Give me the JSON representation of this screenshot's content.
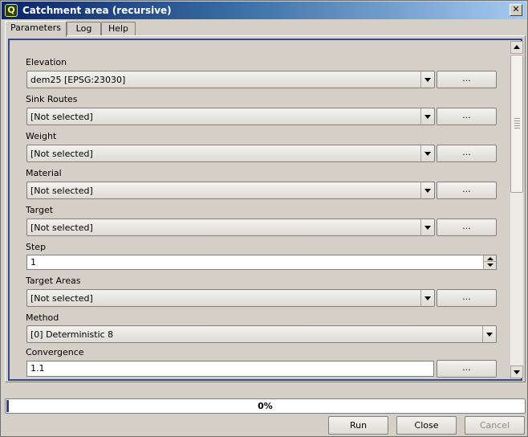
{
  "window": {
    "title": "Catchment area (recursive)",
    "close_glyph": "✕"
  },
  "tabs": [
    {
      "label": "Parameters",
      "active": true
    },
    {
      "label": "Log",
      "active": false
    },
    {
      "label": "Help",
      "active": false
    }
  ],
  "params": [
    {
      "label": "Elevation",
      "value": "dem25 [EPSG:23030]",
      "kind": "layer"
    },
    {
      "label": "Sink Routes",
      "value": "[Not selected]",
      "kind": "layer"
    },
    {
      "label": "Weight",
      "value": "[Not selected]",
      "kind": "layer"
    },
    {
      "label": "Material",
      "value": "[Not selected]",
      "kind": "layer"
    },
    {
      "label": "Target",
      "value": "[Not selected]",
      "kind": "layer"
    },
    {
      "label": "Step",
      "value": "1",
      "kind": "spin"
    },
    {
      "label": "Target Areas",
      "value": "[Not selected]",
      "kind": "layer"
    },
    {
      "label": "Method",
      "value": "[0] Deterministic 8",
      "kind": "select"
    },
    {
      "label": "Convergence",
      "value": "1.1",
      "kind": "text"
    }
  ],
  "browse_label": "...",
  "progress": {
    "percent": 0,
    "label": "0%"
  },
  "buttons": {
    "run": "Run",
    "close": "Close",
    "cancel": "Cancel"
  },
  "colors": {
    "title_start": "#0a246a",
    "title_end": "#a6caf0",
    "frame_accent": "#344b85"
  },
  "icons": {
    "app": "qgis-icon",
    "close": "close-icon"
  }
}
